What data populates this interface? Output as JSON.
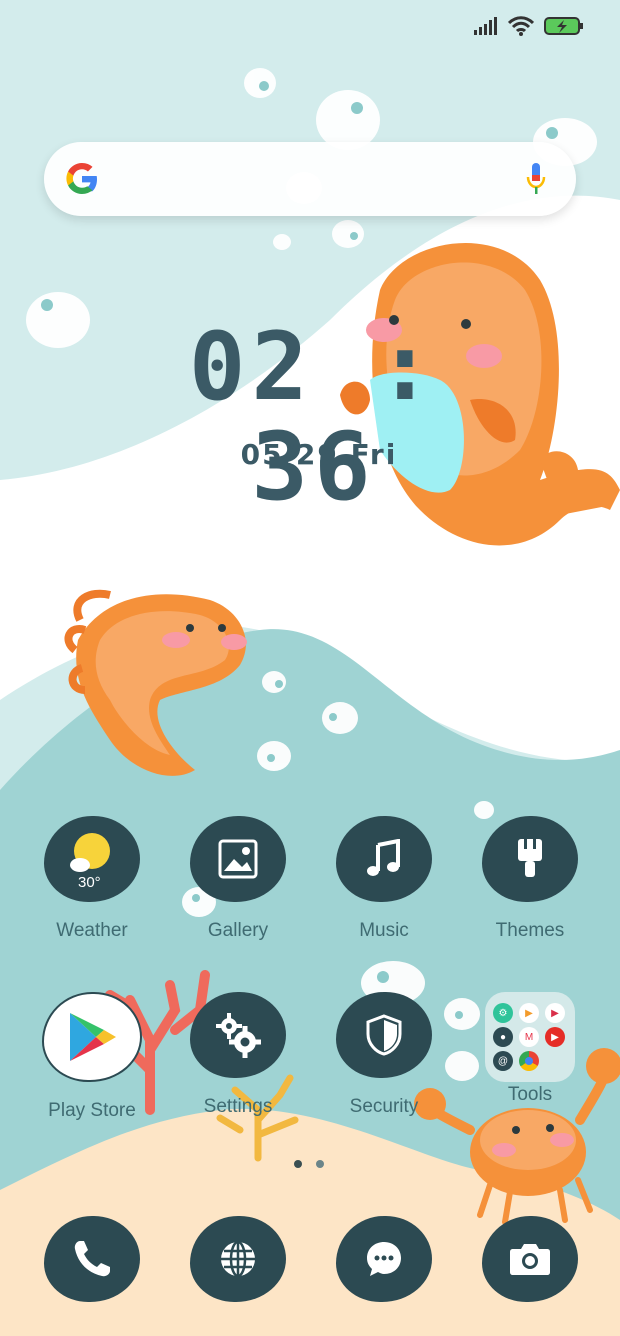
{
  "status_bar": {
    "signal_icon": "signal-bars-icon",
    "wifi_icon": "wifi-icon",
    "battery_icon": "battery-charging-icon"
  },
  "search": {
    "logo_icon": "google-g-icon",
    "mic_icon": "microphone-icon",
    "placeholder": ""
  },
  "clock": {
    "time": "02 : 36",
    "date": "05/29 Fri"
  },
  "apps_row1": [
    {
      "label": "Weather",
      "temp": "30°",
      "icon": "weather-sun-icon"
    },
    {
      "label": "Gallery",
      "icon": "gallery-icon"
    },
    {
      "label": "Music",
      "icon": "music-note-icon"
    },
    {
      "label": "Themes",
      "icon": "paintbrush-icon"
    }
  ],
  "apps_row2": [
    {
      "label": "Play Store",
      "icon": "play-store-icon"
    },
    {
      "label": "Settings",
      "icon": "gear-icon"
    },
    {
      "label": "Security",
      "icon": "shield-icon"
    },
    {
      "label": "Tools",
      "icon": "folder-icon"
    }
  ],
  "dock": [
    {
      "icon": "phone-icon"
    },
    {
      "icon": "browser-globe-icon"
    },
    {
      "icon": "messages-icon"
    },
    {
      "icon": "camera-icon"
    }
  ],
  "page_indicator": {
    "pages": 2,
    "current": 1
  },
  "colors": {
    "sky": "#d3ecec",
    "wave_white": "#ffffff",
    "sea": "#9fd3d3",
    "sand": "#fde5c6",
    "icon_dark": "#2c4a52",
    "clock_text": "#3b5a66",
    "fish_orange": "#f5913a"
  }
}
